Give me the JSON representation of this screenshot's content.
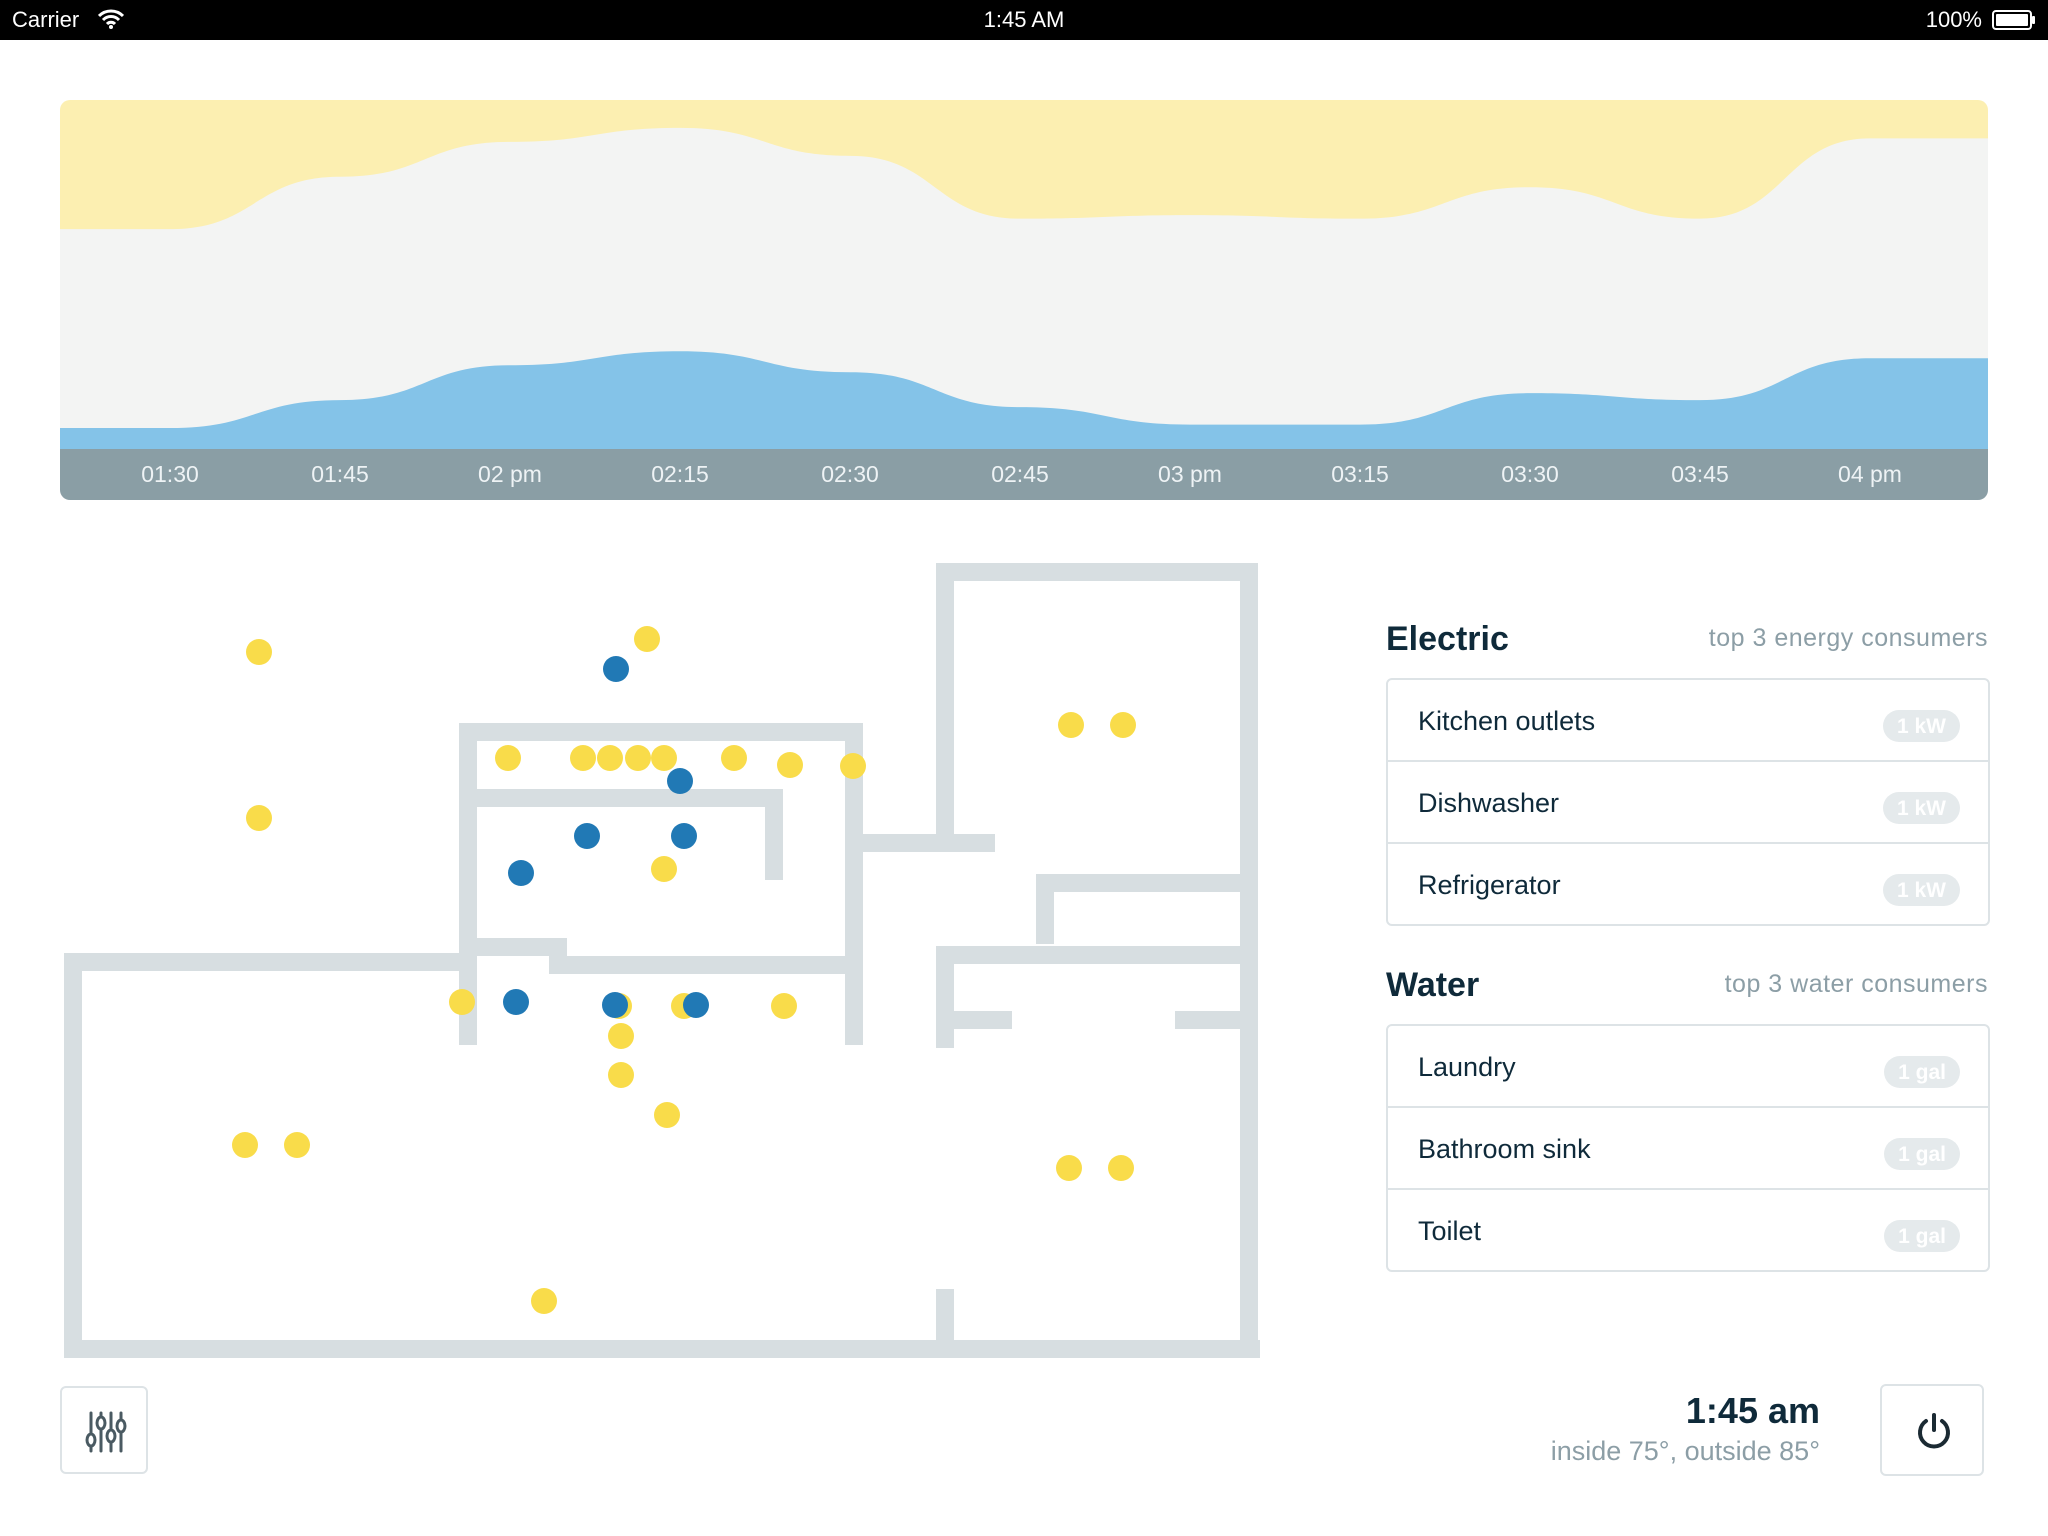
{
  "status_bar": {
    "carrier": "Carrier",
    "time": "1:45 AM",
    "battery": "100%"
  },
  "chart_data": {
    "type": "area",
    "x": [
      "01:30",
      "01:45",
      "02 pm",
      "02:15",
      "02:30",
      "02:45",
      "03 pm",
      "03:15",
      "03:30",
      "03:45",
      "04 pm"
    ],
    "series": [
      {
        "color": "#84c3e8",
        "values": [
          0.06,
          0.14,
          0.24,
          0.28,
          0.22,
          0.12,
          0.07,
          0.07,
          0.16,
          0.14,
          0.26
        ]
      },
      {
        "color": "#f3f4f3",
        "values": [
          0.57,
          0.64,
          0.64,
          0.64,
          0.62,
          0.54,
          0.6,
          0.59,
          0.59,
          0.52,
          0.63
        ]
      },
      {
        "color": "#fcefb1",
        "values": [
          0.37,
          0.22,
          0.12,
          0.08,
          0.16,
          0.34,
          0.33,
          0.34,
          0.25,
          0.34,
          0.11
        ]
      }
    ],
    "stacked": true,
    "ylim": [
      0,
      1
    ]
  },
  "floorplan": {
    "wall_color": "#d7dee1",
    "yellow_color": "#f9dc4a",
    "blue_color": "#2179b5"
  },
  "electric": {
    "title": "Electric",
    "subtitle": "top 3 energy consumers",
    "items": [
      {
        "label": "Kitchen outlets",
        "value": "1 kW"
      },
      {
        "label": "Dishwasher",
        "value": "1 kW"
      },
      {
        "label": "Refrigerator",
        "value": "1 kW"
      }
    ]
  },
  "water": {
    "title": "Water",
    "subtitle": "top 3 water consumers",
    "items": [
      {
        "label": "Laundry",
        "value": "1 gal"
      },
      {
        "label": "Bathroom sink",
        "value": "1 gal"
      },
      {
        "label": "Toilet",
        "value": "1 gal"
      }
    ]
  },
  "footer": {
    "time": "1:45 am",
    "temps": "inside 75°, outside 85°",
    "settings_icon": "sliders-icon",
    "power_icon": "power-icon"
  }
}
